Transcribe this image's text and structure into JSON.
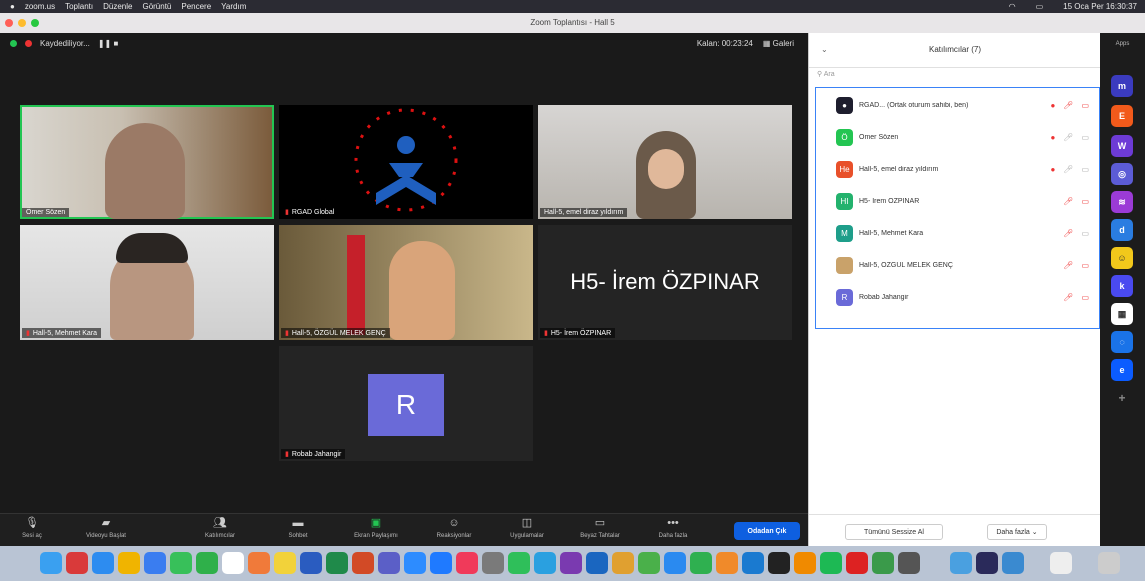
{
  "menubar": {
    "items": [
      "zoom.us",
      "Toplantı",
      "Düzenle",
      "Görüntü",
      "Pencere",
      "Yardım"
    ],
    "status": "15 Oca Per 16:30:37"
  },
  "window": {
    "title": "Zoom Toplantısı - Hall 5"
  },
  "stage": {
    "recording": "Kaydediliyor...",
    "timer": "Kalan: 00:23:24",
    "view": "Galeri"
  },
  "tiles": [
    {
      "name": "Ömer Sözen"
    },
    {
      "name": "RGAD Global"
    },
    {
      "name": "Hall-5, emel diraz yıldırım"
    },
    {
      "name": "Hall-5, Mehmet Kara"
    },
    {
      "name": "Hall-5, ÖZGÜL MELEK GENÇ"
    },
    {
      "name": "H5- İrem ÖZPINAR",
      "big": "H5- İrem ÖZPINAR"
    },
    {
      "name": "Robab Jahangir",
      "initial": "R"
    }
  ],
  "toolbar": {
    "items": [
      {
        "label": "Sesi aç",
        "icon": "microphone-muted-icon"
      },
      {
        "label": "Videoyu Başlat",
        "icon": "video-off-icon"
      },
      {
        "label": "Katılımcılar",
        "icon": "participants-icon"
      },
      {
        "label": "Sohbet",
        "icon": "chat-icon"
      },
      {
        "label": "Ekran Paylaşımı",
        "icon": "share-screen-icon"
      },
      {
        "label": "Reaksiyonlar",
        "icon": "reactions-icon"
      },
      {
        "label": "Uygulamalar",
        "icon": "apps-icon"
      },
      {
        "label": "Beyaz Tahtalar",
        "icon": "whiteboard-icon"
      },
      {
        "label": "Daha fazla",
        "icon": "more-icon"
      }
    ],
    "end": "Odadan Çık"
  },
  "panel": {
    "title": "Katılımcılar (7)",
    "search_placeholder": "Ara",
    "participants": [
      {
        "initials": "",
        "name": "RGAD... (Ortak oturum sahibi, ben)",
        "color": "#1e1e2e"
      },
      {
        "initials": "Ö",
        "name": "Ömer Sözen",
        "color": "#23c552"
      },
      {
        "initials": "He",
        "name": "Hall-5, emel diraz yıldırım",
        "color": "#e8502a"
      },
      {
        "initials": "HI",
        "name": "H5- İrem ÖZPINAR",
        "color": "#23b26d"
      },
      {
        "initials": "M",
        "name": "Hall-5, Mehmet Kara",
        "color": "#1e9e8a"
      },
      {
        "initials": "",
        "name": "Hall-5, ÖZGÜL MELEK GENÇ",
        "color": "#c9a26a"
      },
      {
        "initials": "R",
        "name": "Robab Jahangir",
        "color": "#6a6ad8"
      }
    ],
    "invite": "Tümünü Sessize Al",
    "more": "Daha fazla"
  },
  "apps": {
    "label": "Apps"
  }
}
